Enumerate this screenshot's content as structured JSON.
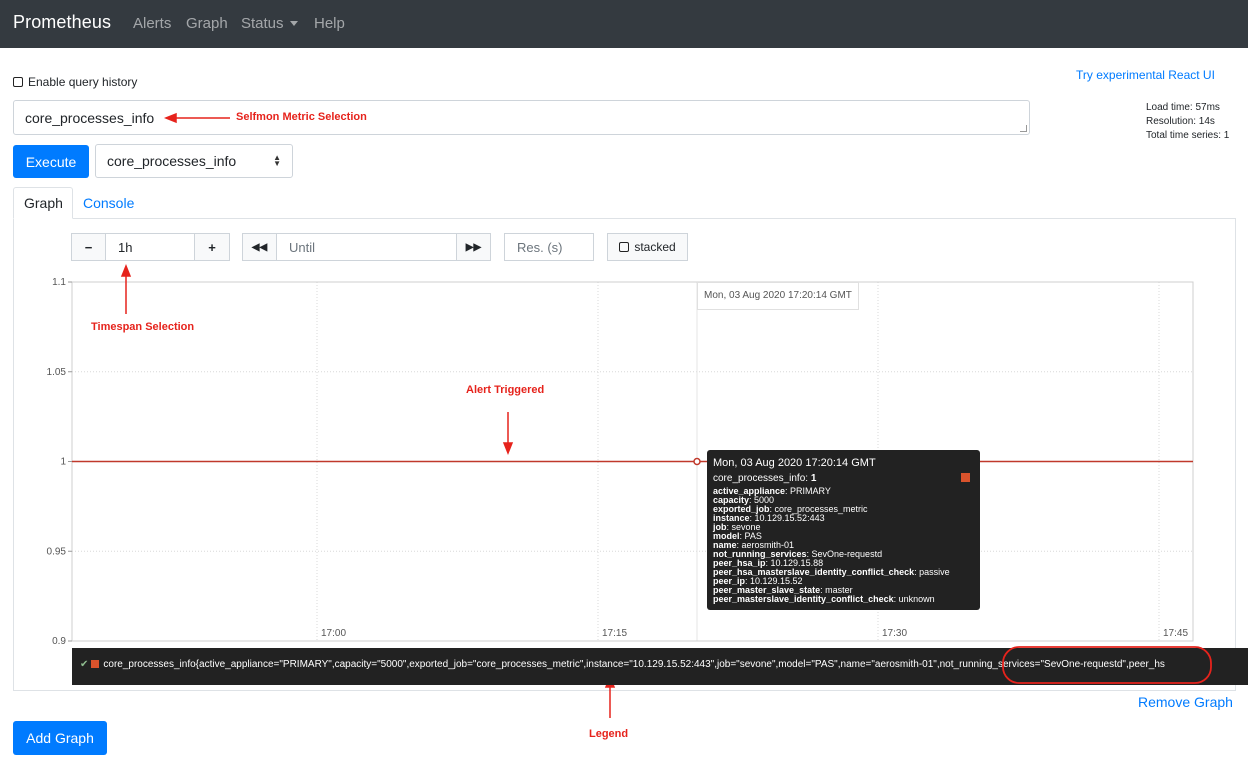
{
  "navbar": {
    "brand": "Prometheus",
    "links": [
      "Alerts",
      "Graph",
      "Status",
      "Help"
    ]
  },
  "query_history_label": "Enable query history",
  "react_ui_link": "Try experimental React UI",
  "stats": {
    "load_time": "Load time: 57ms",
    "resolution": "Resolution: 14s",
    "total_series": "Total time series: 1"
  },
  "expression": "core_processes_info",
  "execute_label": "Execute",
  "metric_select": "core_processes_info",
  "tabs": [
    "Graph",
    "Console"
  ],
  "controls": {
    "minus": "−",
    "range": "1h",
    "plus": "+",
    "back": "◀◀",
    "until_placeholder": "Until",
    "forward": "▶▶",
    "res_placeholder": "Res. (s)",
    "stacked": "stacked"
  },
  "hover_time": "Mon, 03 Aug 2020 17:20:14 GMT",
  "tooltip": {
    "time": "Mon, 03 Aug 2020 17:20:14 GMT",
    "series": "core_processes_info:",
    "series_value": "1",
    "labels": [
      {
        "k": "active_appliance",
        "v": "PRIMARY"
      },
      {
        "k": "capacity",
        "v": "5000"
      },
      {
        "k": "exported_job",
        "v": "core_processes_metric"
      },
      {
        "k": "instance",
        "v": "10.129.15.52:443"
      },
      {
        "k": "job",
        "v": "sevone"
      },
      {
        "k": "model",
        "v": "PAS"
      },
      {
        "k": "name",
        "v": "aerosmith-01"
      },
      {
        "k": "not_running_services",
        "v": "SevOne-requestd"
      },
      {
        "k": "peer_hsa_ip",
        "v": "10.129.15.88"
      },
      {
        "k": "peer_hsa_masterslave_identity_conflict_check",
        "v": "passive"
      },
      {
        "k": "peer_ip",
        "v": "10.129.15.52"
      },
      {
        "k": "peer_master_slave_state",
        "v": "master"
      },
      {
        "k": "peer_masterslave_identity_conflict_check",
        "v": "unknown"
      }
    ]
  },
  "legend_text": "core_processes_info{active_appliance=\"PRIMARY\",capacity=\"5000\",exported_job=\"core_processes_metric\",instance=\"10.129.15.52:443\",job=\"sevone\",model=\"PAS\",name=\"aerosmith-01\",not_running_services=\"SevOne-requestd\",peer_hs",
  "remove_graph": "Remove Graph",
  "add_graph": "Add Graph",
  "annotations": {
    "metric_selection": "Selfmon Metric Selection",
    "timespan_selection": "Timespan Selection",
    "alert_triggered": "Alert Triggered",
    "legend": "Legend"
  },
  "colors": {
    "navbar": "#343a40",
    "primary": "#007bff",
    "series": "#c0392b",
    "annotation": "#e6231c"
  },
  "chart_data": {
    "type": "line",
    "x_ticks": [
      "17:00",
      "17:15",
      "17:30",
      "17:45"
    ],
    "y_ticks": [
      "0.9",
      "0.95",
      "1",
      "1.05",
      "1.1"
    ],
    "ylim": [
      0.9,
      1.1
    ],
    "series": [
      {
        "name": "core_processes_info",
        "values": [
          1,
          1
        ]
      }
    ],
    "hover_point": {
      "x": "17:20:14",
      "y": 1
    }
  }
}
